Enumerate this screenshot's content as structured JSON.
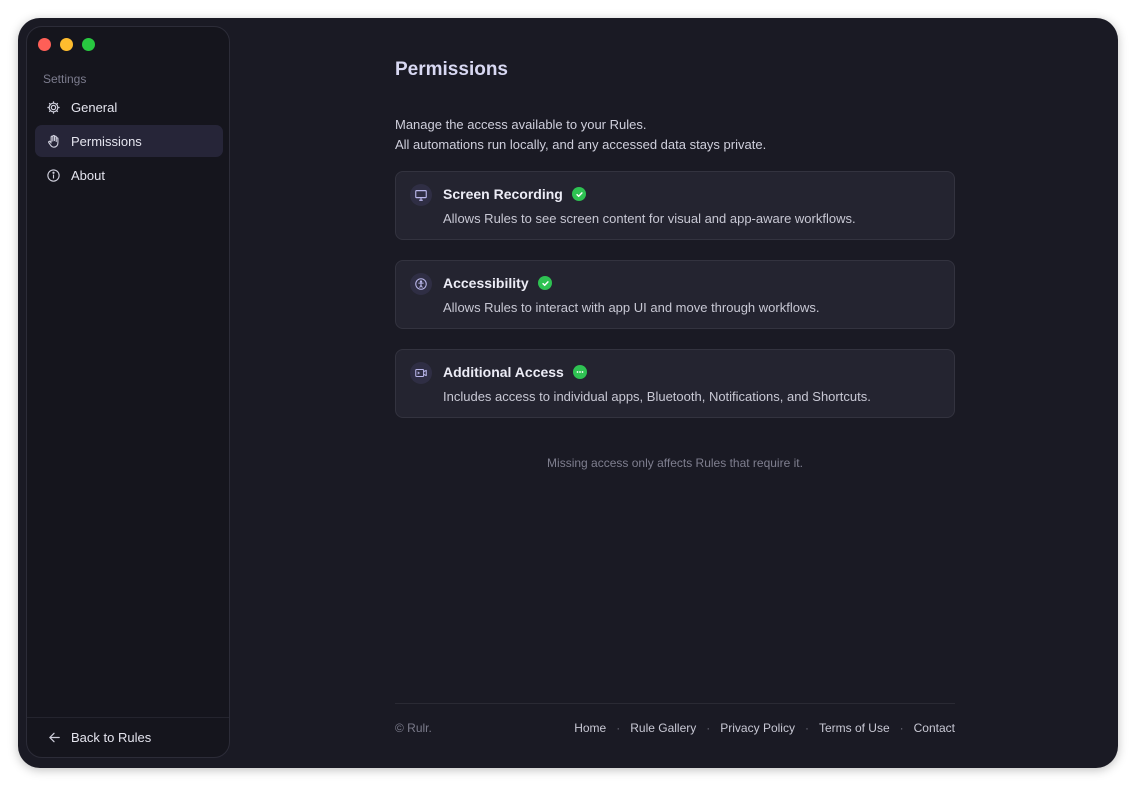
{
  "sidebar": {
    "heading": "Settings",
    "items": [
      {
        "label": "General",
        "icon": "gear-icon"
      },
      {
        "label": "Permissions",
        "icon": "hand-icon",
        "active": true
      },
      {
        "label": "About",
        "icon": "info-icon"
      }
    ],
    "back_label": "Back to Rules"
  },
  "main": {
    "title": "Permissions",
    "description_line1": "Manage the access available to your Rules.",
    "description_line2": "All automations run locally, and any accessed data stays private.",
    "cards": [
      {
        "title": "Screen Recording",
        "status": "granted",
        "icon": "display-icon",
        "description": "Allows Rules to see screen content for visual and app-aware workflows."
      },
      {
        "title": "Accessibility",
        "status": "granted",
        "icon": "accessibility-icon",
        "description": "Allows Rules to interact with app UI and move through workflows."
      },
      {
        "title": "Additional Access",
        "status": "partial",
        "icon": "access-icon",
        "description": "Includes access to individual apps, Bluetooth, Notifications, and Shortcuts."
      }
    ],
    "note": "Missing access only affects Rules that require it."
  },
  "footer": {
    "copyright": "© Rulr.",
    "links": [
      "Home",
      "Rule Gallery",
      "Privacy Policy",
      "Terms of Use",
      "Contact"
    ]
  },
  "colors": {
    "accent": "#262538",
    "status_green": "#2ec252",
    "window_bg": "#1a1a24"
  }
}
